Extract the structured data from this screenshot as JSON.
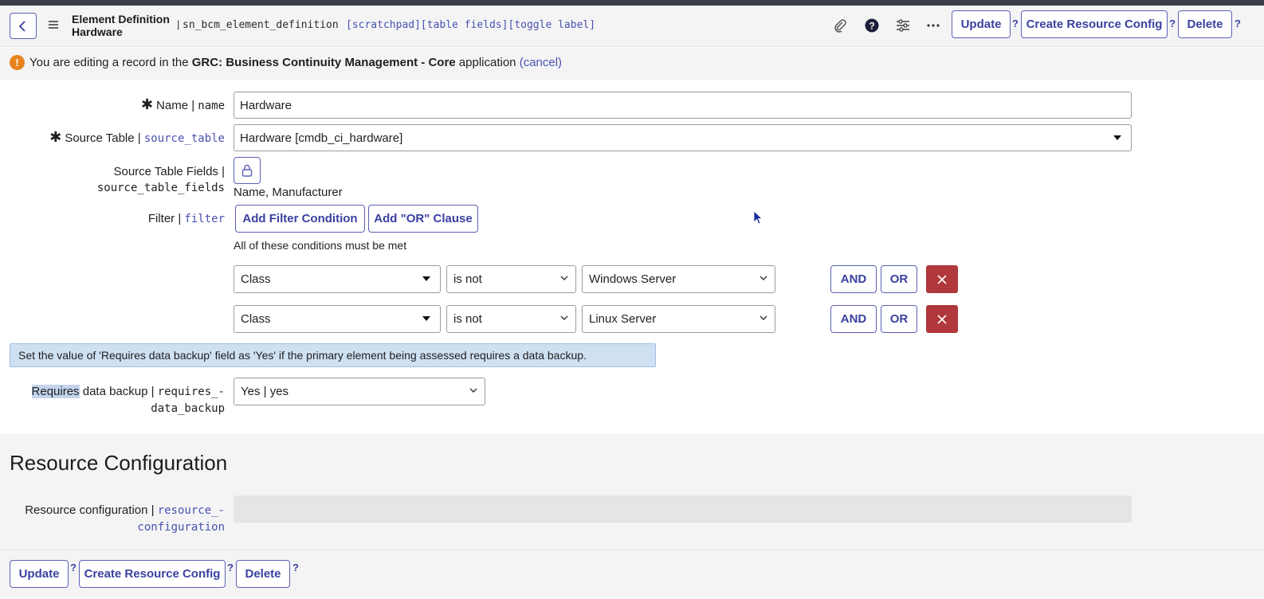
{
  "header": {
    "title_line1": "Element Definition",
    "title_line2": "Hardware",
    "separator": "|",
    "table_name": "sn_bcm_element_definition",
    "links": "[scratchpad][table fields][toggle label]",
    "buttons": {
      "update": "Update",
      "create_resource_config": "Create Resource Config",
      "delete": "Delete"
    },
    "help_mark": "?",
    "icons": [
      "paperclip-icon",
      "help-icon",
      "settings-sliders-icon",
      "more-icon"
    ]
  },
  "banner": {
    "icon": "!",
    "prefix": "You are editing a record in the ",
    "app": "GRC: Business Continuity Management - Core",
    "suffix": " application ",
    "cancel": "(cancel)"
  },
  "form": {
    "name": {
      "label": "Name | ",
      "field": "name",
      "value": "Hardware",
      "required_mark": "✱"
    },
    "source_table": {
      "label": "Source Table | ",
      "field": "source_table",
      "value": "Hardware [cmdb_ci_hardware]",
      "required_mark": "✱"
    },
    "source_table_fields": {
      "label": "Source Table Fields |",
      "field": "source_table_fields",
      "value": "Name, Manufacturer"
    },
    "filter": {
      "label": "Filter | ",
      "field": "filter",
      "add_condition": "Add Filter Condition",
      "add_or": "Add \"OR\" Clause",
      "note": "All of these conditions must be met",
      "and_label": "AND",
      "or_label": "OR",
      "conditions": [
        {
          "field": "Class",
          "operator": "is not",
          "value": "Windows Server"
        },
        {
          "field": "Class",
          "operator": "is not",
          "value": "Linux Server"
        }
      ]
    },
    "info_message": "Set the value of 'Requires data backup' field as 'Yes' if the primary element being assessed requires a data backup.",
    "requires_backup": {
      "label_highlight": "Requires",
      "label_rest": " data backup | ",
      "field_line1": "requires_-",
      "field_line2": "data_backup",
      "value": "Yes | yes"
    }
  },
  "resource_section": {
    "title": "Resource Configuration",
    "label": "Resource configuration | ",
    "field_line1": "resource_-",
    "field_line2": "configuration"
  },
  "footer": {
    "update": "Update",
    "create_resource_config": "Create Resource Config",
    "delete": "Delete",
    "help_mark": "?"
  },
  "colors": {
    "accent": "#3b41a0",
    "warning": "#e8821e",
    "danger": "#b0373b",
    "info_bg": "#cfe0f3"
  }
}
